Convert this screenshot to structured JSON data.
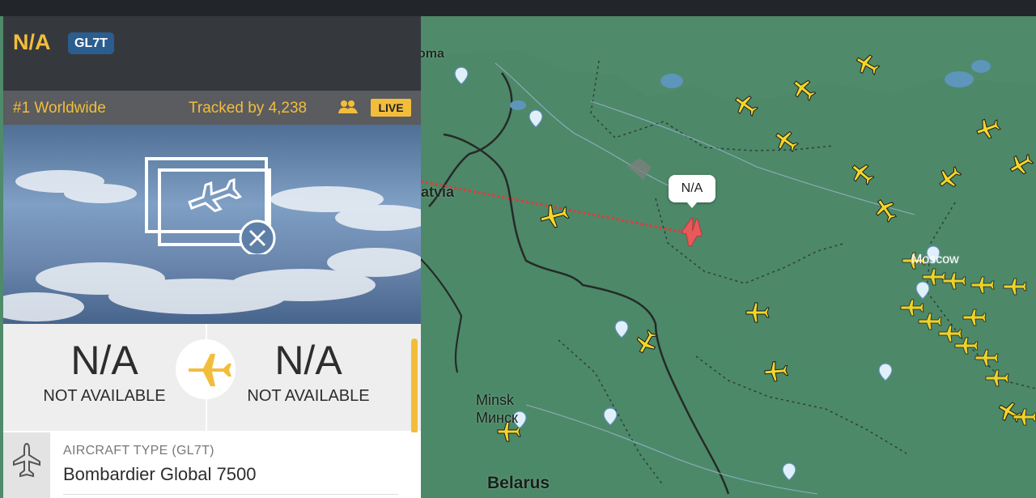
{
  "flight": {
    "title": "N/A",
    "aircraft_code": "GL7T",
    "rank": "#1 Worldwide",
    "tracked_prefix": "Tracked by ",
    "tracked_count": "4,238",
    "live_label": "LIVE"
  },
  "route": {
    "origin_code": "N/A",
    "origin_city": "NOT AVAILABLE",
    "destination_code": "N/A",
    "destination_city": "NOT AVAILABLE"
  },
  "aircraft": {
    "label": "AIRCRAFT TYPE",
    "code": "(GL7T)",
    "type": "Bombardier Global 7500"
  },
  "map": {
    "selected_label": "N/A",
    "labels": {
      "latvia": "atvia",
      "minsk": "Minsk",
      "minsk_local": "Минск",
      "belarus": "Belarus",
      "moscow": "Moscow",
      "top_partial": "oma"
    }
  },
  "colors": {
    "accent": "#f3bd3c",
    "map_land": "#4f8a6a",
    "selected_aircraft": "#e85a5a",
    "panel_header": "#35393d",
    "badge": "#2b5d8f"
  },
  "icons": {
    "aircraft_type": "airplane-icon",
    "no_photo": "no-photo-icon",
    "tracked": "people-icon",
    "route": "airplane-icon"
  }
}
